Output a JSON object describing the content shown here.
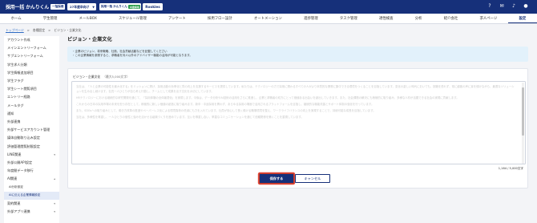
{
  "header": {
    "logo_text": "採用一括 かんりくん",
    "logo_tag": "一括採用",
    "year_select": "27年度卒向け",
    "brand2_text": "採用一括 かんりくん",
    "brand2_badge": "中途採用",
    "rookies": "Rookies",
    "icons": [
      "help-icon",
      "chat-icon",
      "bell-icon",
      "user-icon"
    ]
  },
  "nav": {
    "items": [
      "ホーム",
      "学生管理",
      "メールBOX",
      "スケジュール管理",
      "アンケート",
      "採用フロー設計",
      "オートメーション",
      "進捗管理",
      "タスク管理",
      "適性検査",
      "分析",
      "紹介会社",
      "求人ページ",
      "設定"
    ]
  },
  "breadcrumb": [
    "トップページ",
    "各種設定",
    "ビジョン・企業文化"
  ],
  "sidebar": {
    "items": [
      {
        "label": "アカウント作成"
      },
      {
        "label": "メインエントリーフォーム"
      },
      {
        "label": "サブエントリーフォーム"
      },
      {
        "label": "学生求人分類"
      },
      {
        "label": "学生情報追加項目"
      },
      {
        "label": "学生フラグ"
      },
      {
        "label": "学生シート閲覧項目"
      },
      {
        "label": "エントリー経路"
      },
      {
        "label": "メールタグ"
      },
      {
        "label": "通知"
      },
      {
        "label": "外部連携"
      },
      {
        "label": "外部サービスアカウント管理"
      },
      {
        "label": "媒体自動取り込み設定"
      },
      {
        "label": "評価管理閲覧制限設定"
      },
      {
        "label": "LINE関連"
      },
      {
        "label": "外部公開API設定"
      },
      {
        "label": "年度間データ移行"
      },
      {
        "label": "AI関連"
      }
    ],
    "ai_sub": [
      "AI分析設定",
      "AIに伝える企業情報設定"
    ],
    "bottom": [
      {
        "label": "契約関連"
      },
      {
        "label": "外部アプリ連携"
      }
    ]
  },
  "main": {
    "title": "ビジョン・企業文化",
    "info_lines": [
      "・企業のビジョン、将来戦略、社風、社会貢献活動などを記載してください",
      "・この企業情報を参照すると、求職者を対人以外のアドバイザー機能の活用が可能となります。"
    ],
    "field_label": "ビジョン・企業文化",
    "field_limit": "（最大5,000文字）",
    "paragraphs": [
      "当社は、「人と企業の可能性を最大化する」をミッションに掲げ、採用活動の効率化と質の向上を支援するサービスを提供しています。私たちは、テクノロジーの力で採用に関わるすべての人がより本質的な業務に集中できる環境をつくることを目指しています。変化の激しい時代においても、挑戦を恐れず、常に顧客の声に耳を傾けながら、最適なソリューションを生み出し続けます。社員一人ひとりが自ら考え行動し、チームとして成果を出す文化を大切にしています。",
      "HRテクノロジーにおける継続的な研究開発を通じて、「採用体験の全体最適化」を実現します。今後は、データ分析やAI技術の活用をさらに推進し、企業と求職者の双方にとって価値ある出会いを創出していきます。また、社会課題の解決にも積極的に取り組み、多様な人材が活躍できる社会の実現に貢献します。",
      "これからの日本の採用市場の未来を担う存在として、積極的に新しい価値の創造に取り組みます。新卒・中途採用を問わず、あらゆる採用の場面で活用されるプラットフォームを目指し、継続的な機能改善とサポート体制の強化を行っています。",
      "また、SDGsへの取り組みとして、働き方改革の推進やペーパーレス化による環境負荷の低減にも力を入れています。社員が安心して長く働ける職場環境を整え、ワークライフバランスの向上を実現することで、持続可能な成長を目指しています。",
      "当社は、多様性を尊重し、一人ひとりの個性と強みを活かせる組織づくりを進めています。互いを尊重し合い、率直なコミュニケーションを通じて信頼関係を築くことを重視しています。"
    ],
    "char_count": "1,164 / 5,000文字",
    "save_label": "保存する",
    "cancel_label": "キャンセル"
  }
}
